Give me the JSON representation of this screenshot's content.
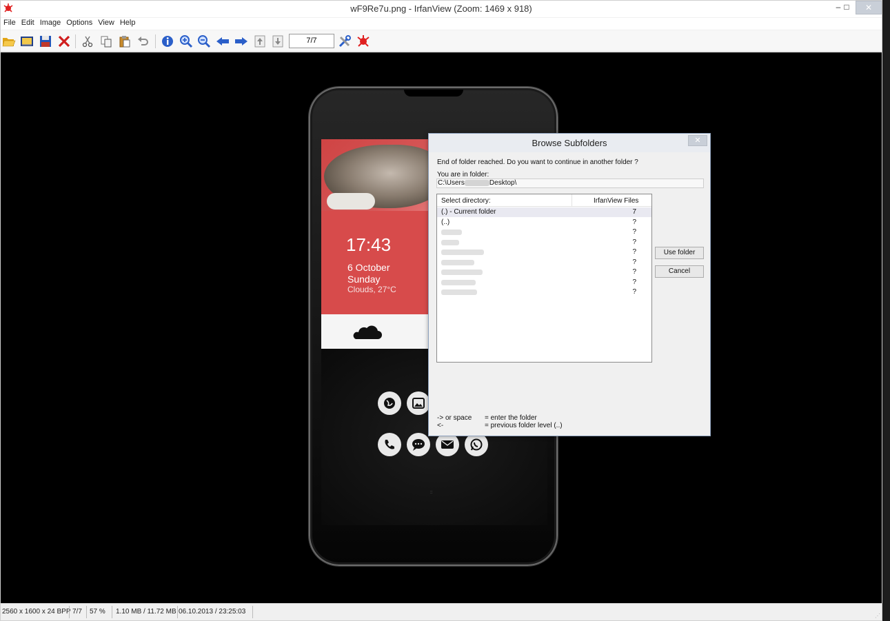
{
  "window": {
    "title": "wF9Re7u.png - IrfanView (Zoom: 1469 x 918)",
    "minimize": "–",
    "maximize": "□",
    "close": "✕"
  },
  "menu": [
    "File",
    "Edit",
    "Image",
    "Options",
    "View",
    "Help"
  ],
  "toolbar": {
    "icons": [
      "open-folder-icon",
      "thumbnails-icon",
      "save-icon",
      "delete-icon",
      "cut-icon",
      "copy-icon",
      "paste-icon",
      "undo-icon",
      "info-icon",
      "zoom-in-icon",
      "zoom-out-icon",
      "previous-icon",
      "next-icon",
      "page-up-icon",
      "page-down-icon",
      "settings-icon",
      "exit-icon"
    ],
    "page_counter": "7/7"
  },
  "image": {
    "time": "17:43",
    "date": "6 October",
    "day": "Sunday",
    "weather": "Clouds, 27°C"
  },
  "dialog": {
    "title": "Browse Subfolders",
    "close": "✕",
    "message": "End of folder reached. Do you want to continue in another folder ?",
    "folder_label": "You are in folder:",
    "path_prefix": "C:\\Users",
    "path_suffix": "Desktop\\",
    "col_select": "Select directory:",
    "col_files": "IrfanView Files",
    "rows": [
      {
        "name": "(.) - Current folder",
        "count": "7"
      },
      {
        "name": "(..)",
        "count": "?"
      },
      {
        "name": "",
        "count": "?"
      },
      {
        "name": "",
        "count": "?"
      },
      {
        "name": "",
        "count": "?"
      },
      {
        "name": "",
        "count": "?"
      },
      {
        "name": "",
        "count": "?"
      },
      {
        "name": "",
        "count": "?"
      },
      {
        "name": "",
        "count": "?"
      }
    ],
    "use_folder": "Use folder",
    "cancel": "Cancel",
    "hint1_key": "-> or space",
    "hint1_desc": "= enter the folder",
    "hint2_key": "<-",
    "hint2_desc": "= previous folder level (..)"
  },
  "status": {
    "dimensions": "2560 x 1600 x 24 BPP",
    "position": "7/7",
    "zoom": "57 %",
    "size": "1.10 MB / 11.72 MB",
    "datetime": "06.10.2013 / 23:25:03"
  }
}
